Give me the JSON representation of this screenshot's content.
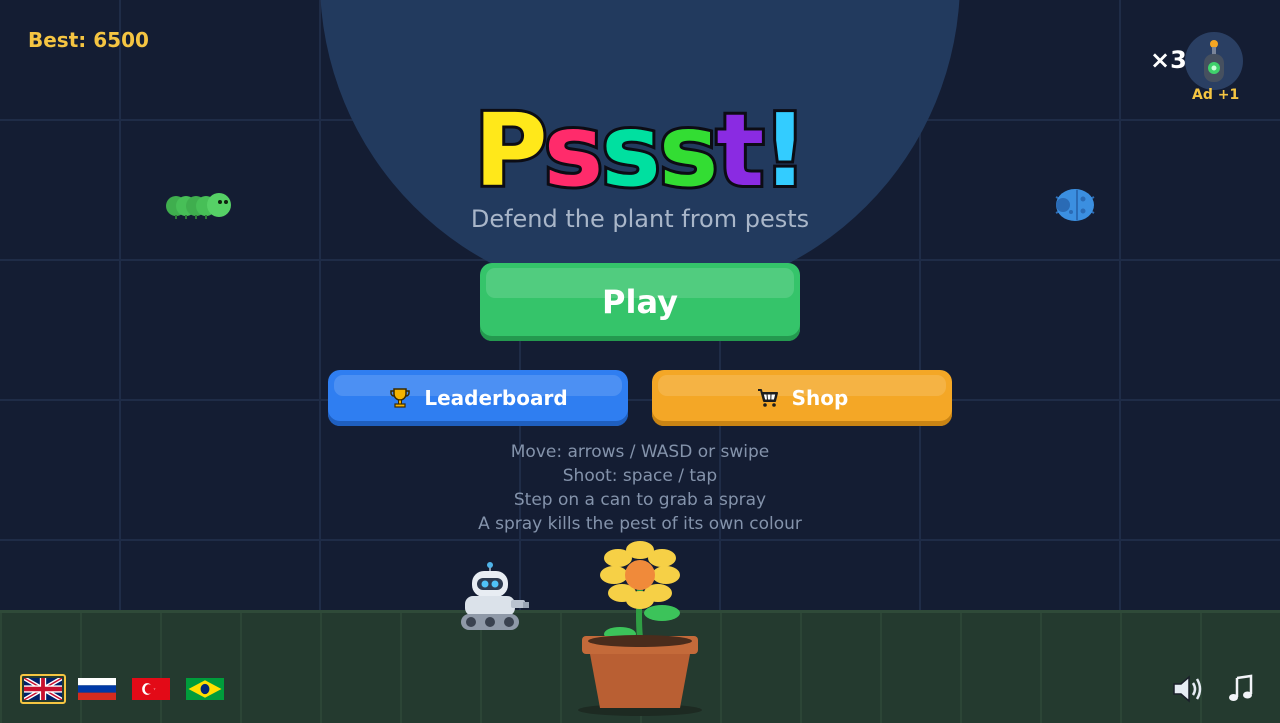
{
  "header": {
    "best_label": "Best: 6500",
    "lives_count": "×3",
    "lives_ad_label": "Ad +1"
  },
  "title": {
    "letters": [
      "P",
      "s",
      "s",
      "s",
      "t",
      "!"
    ],
    "letter_colors": [
      "#ffe81a",
      "#ff2b6b",
      "#00e0a0",
      "#33dd33",
      "#8a2be2",
      "#33ccff"
    ]
  },
  "subtitle": "Defend the plant from pests",
  "buttons": {
    "play_label": "Play",
    "leaderboard_label": "Leaderboard",
    "shop_label": "Shop"
  },
  "instructions": [
    "Move: arrows / WASD or swipe",
    "Shoot: space / tap",
    "Step on a can to grab a spray",
    "A spray kills the pest of its own colour"
  ],
  "languages": [
    {
      "name": "english-flag",
      "active": true
    },
    {
      "name": "russian-flag",
      "active": false
    },
    {
      "name": "turkish-flag",
      "active": false
    },
    {
      "name": "brazilian-flag",
      "active": false
    }
  ],
  "icons": {
    "leaderboard": "trophy-icon",
    "shop": "cart-icon",
    "sound": "speaker-icon",
    "music": "music-note-icon"
  },
  "colors": {
    "play": "#35c46a",
    "leaderboard": "#2f7ef1",
    "shop": "#f4a726",
    "accent": "#f5c542"
  }
}
